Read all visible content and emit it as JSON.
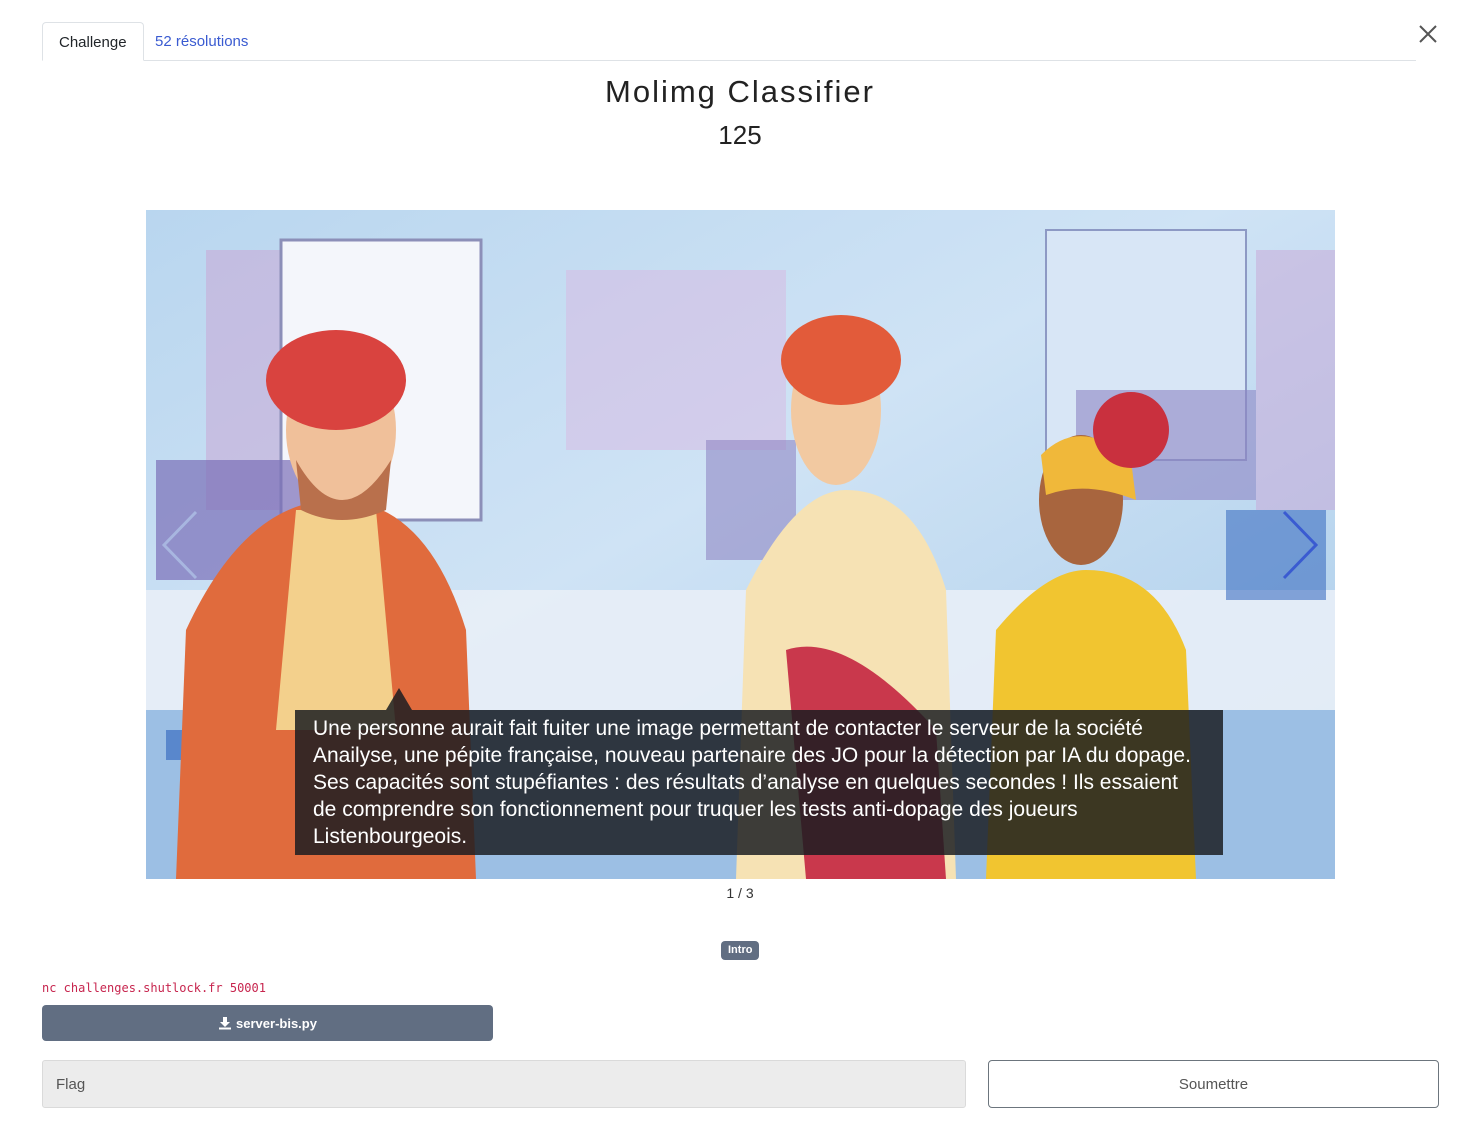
{
  "tabs": [
    {
      "label": "Challenge",
      "active": true
    },
    {
      "label": "52 résolutions",
      "active": false
    }
  ],
  "challenge": {
    "title": "Molimg Classifier",
    "points": "125"
  },
  "carousel": {
    "caption": "Une personne aurait fait fuiter une image permettant de contacter le serveur de la société Anailyse, une pépite française, nouveau partenaire des JO pour la détection par IA du dopage. Ses capacités sont stupéfiantes : des résultats d’analyse en quelques secondes ! Ils essaient de comprendre son fonctionnement pour truquer les tests anti-dopage des joueurs Listenbourgeois.",
    "counter": "1 / 3"
  },
  "tag": "Intro",
  "connection": "nc challenges.shutlock.fr 50001",
  "file": {
    "name": "server-bis.py",
    "icon": "download-icon"
  },
  "flag": {
    "placeholder": "Flag",
    "value": ""
  },
  "submit_label": "Soumettre",
  "colors": {
    "link": "#3a5bd1",
    "badge": "#616e82",
    "code": "#c7254e",
    "nav_next": "#3a5bd1"
  }
}
